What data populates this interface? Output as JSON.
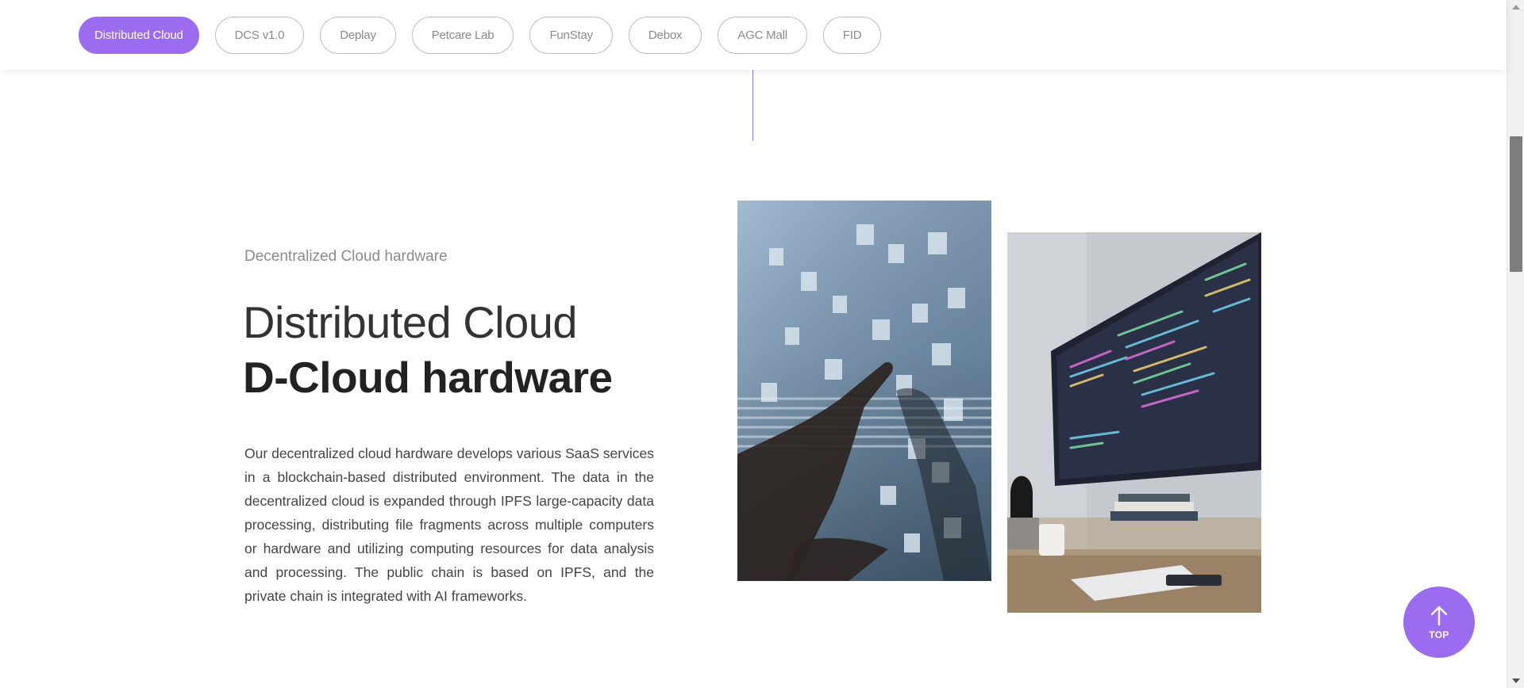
{
  "nav": {
    "tabs": [
      {
        "label": "Distributed Cloud",
        "active": true
      },
      {
        "label": "DCS v1.0",
        "active": false
      },
      {
        "label": "Deplay",
        "active": false
      },
      {
        "label": "Petcare Lab",
        "active": false
      },
      {
        "label": "FunStay",
        "active": false
      },
      {
        "label": "Debox",
        "active": false
      },
      {
        "label": "AGC Mall",
        "active": false
      },
      {
        "label": "FID",
        "active": false
      }
    ]
  },
  "section": {
    "eyebrow": "Decentralized Cloud hardware",
    "title_light": "Distributed Cloud",
    "title_bold": "D-Cloud hardware",
    "description": "Our decentralized cloud hardware develops various SaaS services in a blockchain-based distributed environment. The data in the decentralized cloud is expanded through IPFS large-capacity data processing, distributing file fragments across multiple computers or hardware and utilizing computing resources for data analysis and processing. The public chain is based on IPFS, and the private chain is integrated with AI frameworks."
  },
  "top_button": {
    "label": "TOP",
    "icon": "arrow-up-icon"
  },
  "colors": {
    "accent": "#9b6cf0",
    "divider": "#8b78ff"
  }
}
